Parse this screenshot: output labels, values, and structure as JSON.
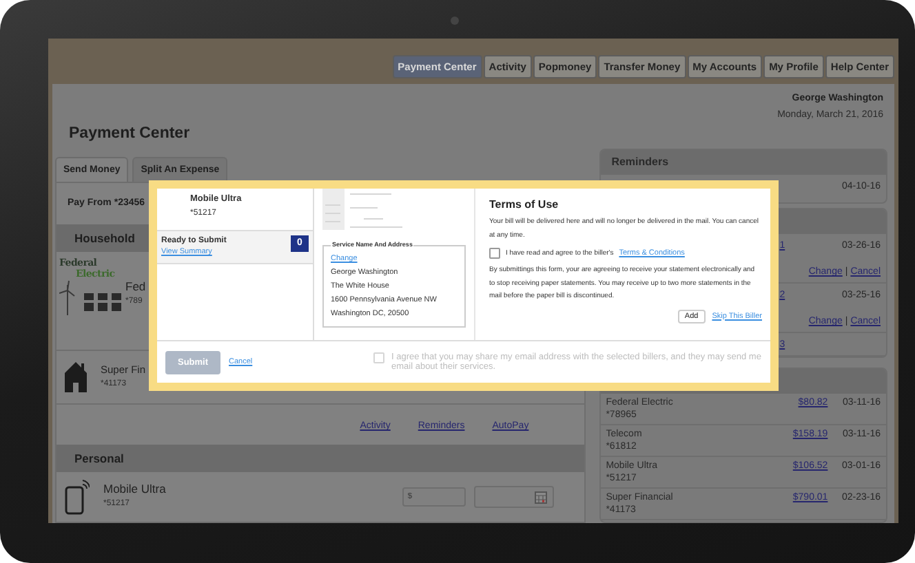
{
  "nav_tabs": [
    {
      "label": "Payment Center",
      "selected": true
    },
    {
      "label": "Activity",
      "selected": false
    },
    {
      "label": "Popmoney",
      "selected": false
    },
    {
      "label": "Transfer Money",
      "selected": false
    },
    {
      "label": "My Accounts",
      "selected": false
    },
    {
      "label": "My Profile",
      "selected": false
    },
    {
      "label": "Help Center",
      "selected": false
    }
  ],
  "user": {
    "name": "George Washington",
    "date": "Monday, March 21, 2016"
  },
  "page_title": "Payment Center",
  "tabs": [
    {
      "label": "Send Money",
      "selected": true
    },
    {
      "label": "Split An Expense",
      "selected": false
    }
  ],
  "pay_from": "Pay From *23456",
  "household": {
    "title": "Household",
    "billers": [
      {
        "kind": "logo",
        "logo_lines": [
          "Federal",
          "Electric"
        ],
        "name": "Fed",
        "account": "*789"
      },
      {
        "kind": "house",
        "name": "Super Fin",
        "account": "*41173"
      }
    ]
  },
  "links": [
    "Activity",
    "Reminders",
    "AutoPay"
  ],
  "personal": {
    "title": "Personal",
    "billers": [
      {
        "kind": "tablet",
        "name": "Mobile Ultra",
        "account": "*51217",
        "amount_placeholder": "$"
      }
    ]
  },
  "reminders": {
    "title": "Reminders",
    "rows": [
      {
        "date": "04-10-16"
      }
    ]
  },
  "scheduled": {
    "rows": [
      {
        "amount": "1",
        "date": "03-26-16",
        "actions": [
          "Change",
          "Cancel"
        ],
        "separator": "|"
      },
      {
        "amount": "2",
        "date": "03-25-16",
        "actions": [
          "Change",
          "Cancel"
        ],
        "separator": "|"
      },
      {
        "amount": "3"
      }
    ]
  },
  "history": {
    "rows": [
      {
        "name": "Federal Electric",
        "account": "*78965",
        "amount": "$80.82",
        "date": "03-11-16"
      },
      {
        "name": "Telecom",
        "account": "*61812",
        "amount": "$158.19",
        "date": "03-11-16"
      },
      {
        "name": "Mobile Ultra",
        "account": "*51217",
        "amount": "$106.52",
        "date": "03-01-16"
      },
      {
        "name": "Super Financial",
        "account": "*41173",
        "amount": "$790.01",
        "date": "02-23-16"
      }
    ]
  },
  "modal": {
    "biller": {
      "name": "Mobile Ultra",
      "account": "*51217"
    },
    "ready": {
      "title": "Ready to Submit",
      "link": "View Summary",
      "count": "0"
    },
    "address": {
      "legend": "Service Name And Address",
      "change": "Change",
      "lines": [
        "George Washington",
        "The White House",
        "1600 Pennsylvania Avenue NW",
        "Washington DC, 20500"
      ]
    },
    "terms": {
      "title": "Terms of Use",
      "intro": "Your bill will be delivered here and will no longer be delivered in the mail. You can cancel at any time.",
      "agree": {
        "label": "I have read and agree to the biller's",
        "link": "Terms & Conditions",
        "checked": false
      },
      "body": "By submittings this form, your are agreeing to receive your statement electronically and to stop receiving paper statements. You may receive up to two more statements in the mail before the paper bill is discontinued.",
      "add": "Add",
      "skip": "Skip This Biller"
    },
    "submit": {
      "label": "Submit",
      "disabled": true
    },
    "cancel": "Cancel",
    "share": {
      "label": "I agree that you may share my email address with the selected billers, and they may send me email about their services.",
      "checked": false,
      "disabled": true
    }
  }
}
